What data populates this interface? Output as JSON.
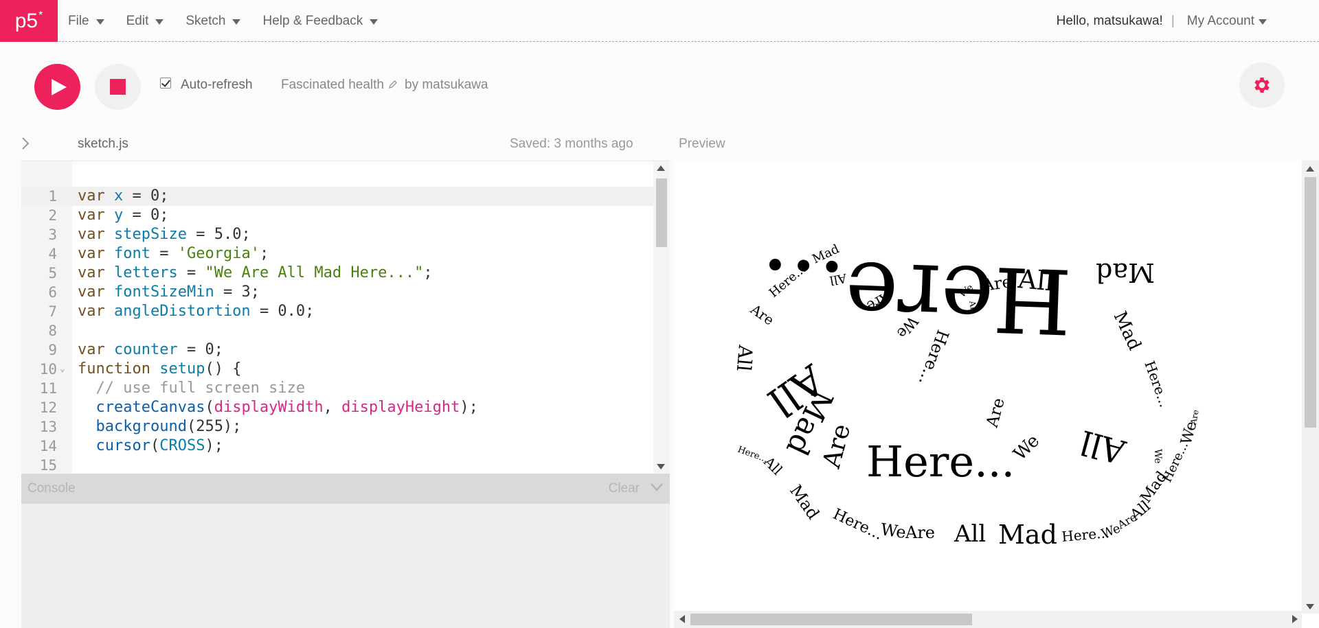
{
  "app": {
    "logo": "p5",
    "logo_mark": "*"
  },
  "nav": {
    "menu": [
      {
        "label": "File"
      },
      {
        "label": "Edit"
      },
      {
        "label": "Sketch"
      },
      {
        "label": "Help & Feedback"
      }
    ],
    "greeting": "Hello, matsukawa!",
    "separator": "|",
    "account_label": "My Account"
  },
  "toolbar": {
    "auto_refresh_label": "Auto-refresh",
    "auto_refresh_checked": true,
    "project_name": "Fascinated health",
    "byline": "by matsukawa"
  },
  "editor": {
    "filename": "sketch.js",
    "saved_status": "Saved: 3 months ago",
    "lines": [
      {
        "n": "1",
        "text": "var x = 0;"
      },
      {
        "n": "2",
        "text": "var y = 0;"
      },
      {
        "n": "3",
        "text": "var stepSize = 5.0;"
      },
      {
        "n": "4",
        "text": "var font = 'Georgia';"
      },
      {
        "n": "5",
        "text": "var letters = \"We Are All Mad Here...\";"
      },
      {
        "n": "6",
        "text": "var fontSizeMin = 3;"
      },
      {
        "n": "7",
        "text": "var angleDistortion = 0.0;"
      },
      {
        "n": "8",
        "text": ""
      },
      {
        "n": "9",
        "text": "var counter = 0;"
      },
      {
        "n": "10",
        "text": "function setup() {"
      },
      {
        "n": "11",
        "text": "  // use full screen size"
      },
      {
        "n": "12",
        "text": "  createCanvas(displayWidth, displayHeight);"
      },
      {
        "n": "13",
        "text": "  background(255);"
      },
      {
        "n": "14",
        "text": "  cursor(CROSS);"
      },
      {
        "n": "15",
        "text": ""
      }
    ]
  },
  "console": {
    "title": "Console",
    "clear_label": "Clear"
  },
  "preview": {
    "label": "Preview",
    "canvas_words": [
      "We",
      "Are",
      "All",
      "Mad",
      "Here..."
    ]
  },
  "colors": {
    "brand": "#ed225d",
    "keyword": "#704f21",
    "variable": "#0b7ca9",
    "string": "#47820a",
    "comment": "#999999",
    "builtin": "#d52889"
  },
  "icons": {
    "play": "play-icon",
    "stop": "stop-icon",
    "gear": "gear-icon",
    "pencil": "pencil-icon",
    "expand": "chevron-right-icon",
    "collapse": "chevron-down-icon"
  }
}
